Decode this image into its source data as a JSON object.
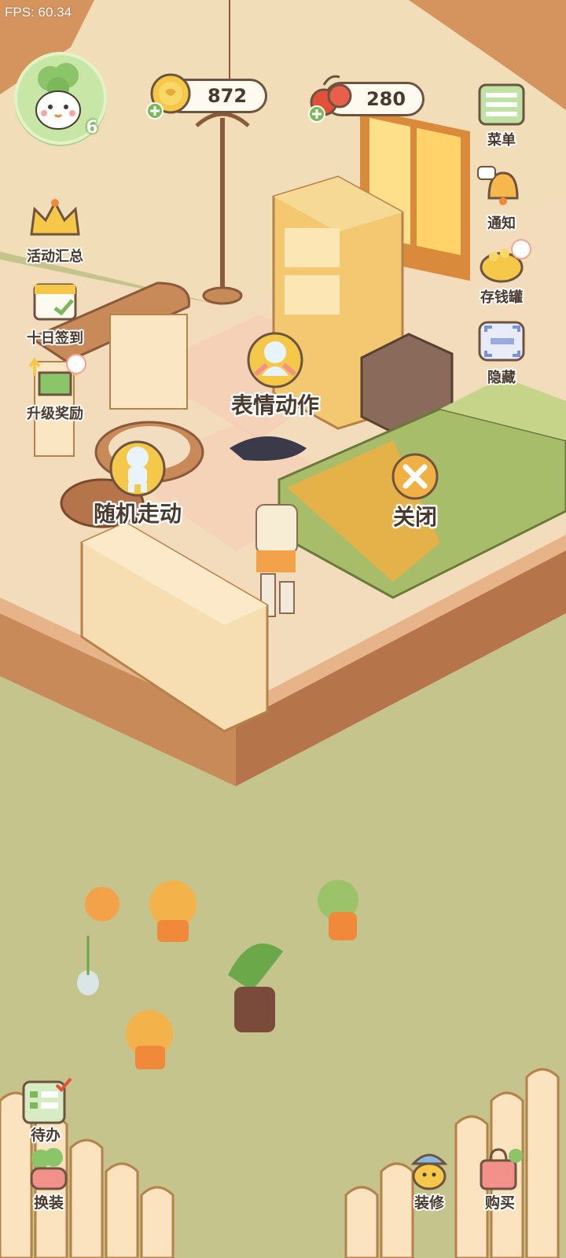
{
  "hud": {
    "fps": "FPS: 60.34",
    "player_level": "6",
    "coins": "872",
    "cherries": "280"
  },
  "left_menu": [
    {
      "id": "events",
      "label": "活动汇总",
      "icon": "crown-icon"
    },
    {
      "id": "checkin",
      "label": "十日签到",
      "icon": "calendar-icon"
    },
    {
      "id": "upgrade",
      "label": "升级奖励",
      "icon": "gift-arrows-icon",
      "has_new_dot": true
    }
  ],
  "right_menu": [
    {
      "id": "menu",
      "label": "菜单",
      "icon": "menu-list-icon"
    },
    {
      "id": "notice",
      "label": "通知",
      "icon": "bell-icon"
    },
    {
      "id": "piggy",
      "label": "存钱罐",
      "icon": "piggy-bank-icon",
      "has_new_dot": true
    },
    {
      "id": "hide",
      "label": "隐藏",
      "icon": "hide-frame-icon"
    }
  ],
  "actions": {
    "emote": "表情动作",
    "walk": "随机走动",
    "close": "关闭"
  },
  "bottom_menu": {
    "todo": "待办",
    "dressup": "换装",
    "decorate": "装修",
    "shop": "购买"
  },
  "colors": {
    "grass": "#c4c48c",
    "floor": "#f3dcbc",
    "wall": "#f2ddb9",
    "wood": "#c98a5a",
    "bed_green": "#a7bd6a",
    "accent_orange": "#f0b043"
  }
}
